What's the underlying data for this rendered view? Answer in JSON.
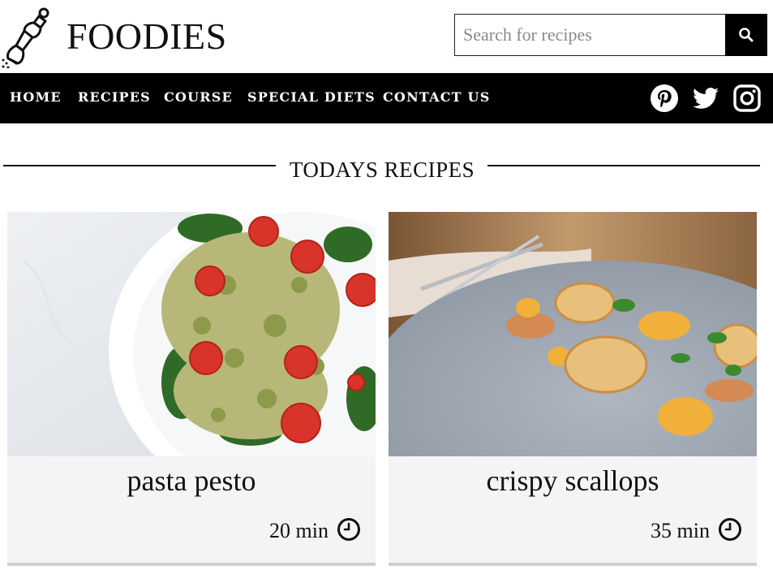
{
  "header": {
    "logo_icon": "pepper-mill-icon",
    "brand": "FOODIES",
    "search": {
      "placeholder": "Search for recipes",
      "value": "",
      "button_icon": "search-icon"
    }
  },
  "nav": {
    "items": [
      {
        "label": "HOME"
      },
      {
        "label": "RECIPES"
      },
      {
        "label": "COURSE"
      },
      {
        "label": "SPECIAL DIETS"
      },
      {
        "label": "CONTACT US"
      }
    ],
    "social": [
      "pinterest-icon",
      "twitter-icon",
      "instagram-icon"
    ]
  },
  "section": {
    "title": "TODAYS RECIPES"
  },
  "cards": [
    {
      "title": "pasta pesto",
      "time": "20 min",
      "image": "pasta-pesto-photo",
      "clock_icon": "clock-icon"
    },
    {
      "title": "crispy scallops",
      "time": "35 min",
      "image": "crispy-scallops-photo",
      "clock_icon": "clock-icon"
    }
  ],
  "colors": {
    "nav_bg": "#000000",
    "card_bg": "#f4f4f6",
    "text": "#111111"
  }
}
